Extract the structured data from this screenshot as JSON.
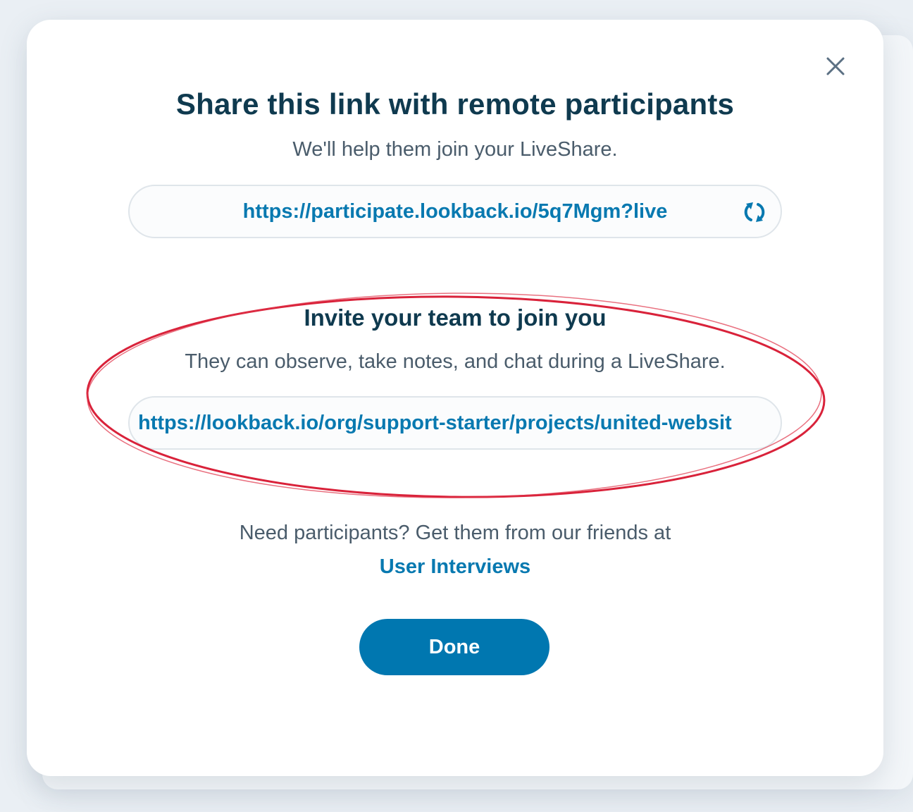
{
  "modal": {
    "title": "Share this link with remote participants",
    "subtitle": "We'll help them join your LiveShare."
  },
  "participant_link": {
    "value": "https://participate.lookback.io/5q7Mgm?live"
  },
  "team": {
    "heading": "Invite your team to join you",
    "description": "They can observe, take notes, and chat during a LiveShare.",
    "link_value": "https://lookback.io/org/support-starter/projects/united-websit"
  },
  "recruit": {
    "text": "Need participants? Get them from our friends at",
    "link_label": "User Interviews"
  },
  "actions": {
    "done_label": "Done"
  },
  "icons": {
    "close": "close-icon",
    "refresh": "refresh-icon"
  },
  "colors": {
    "accent": "#0077b0",
    "link": "#0879b0",
    "heading": "#0f3a4f",
    "annotation": "#d9223a"
  }
}
